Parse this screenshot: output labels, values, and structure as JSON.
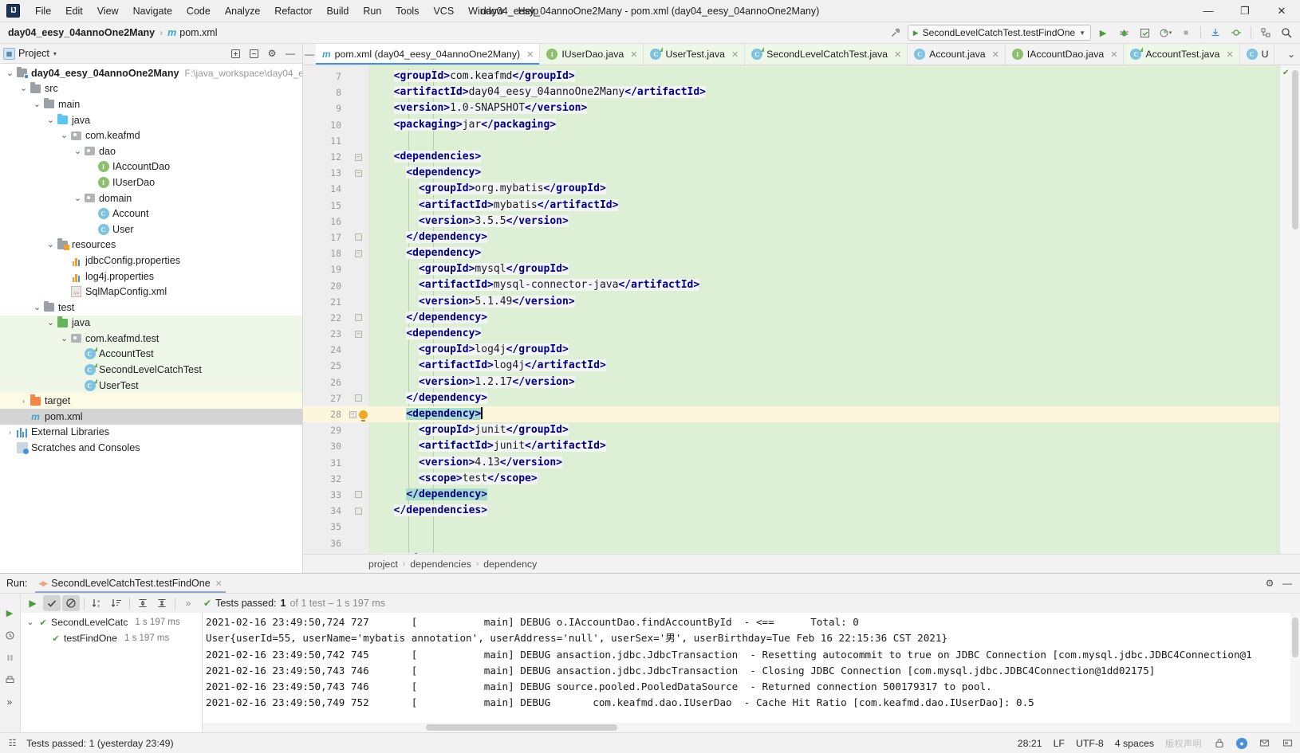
{
  "titlebar": {
    "logo": "IJ",
    "menus": [
      "File",
      "Edit",
      "View",
      "Navigate",
      "Code",
      "Analyze",
      "Refactor",
      "Build",
      "Run",
      "Tools",
      "VCS",
      "Window",
      "Help"
    ],
    "window_title": "day04_eesy_04annoOne2Many - pom.xml (day04_eesy_04annoOne2Many)",
    "minimize": "—",
    "maximize": "❐",
    "close": "✕"
  },
  "navbar": {
    "project": "day04_eesy_04annoOne2Many",
    "separator": "›",
    "file_icon": "m",
    "file": "pom.xml",
    "build_icon": "build-hammer-icon",
    "run_config": "SecondLevelCatchTest.testFindOne",
    "run_button": "▶",
    "debug_button": "🐞",
    "coverage_button": "▣",
    "profile_button": "◔",
    "stop_button": "■",
    "layout_button": "☷",
    "search_everywhere": "🔍",
    "settings_button": "⚙"
  },
  "project_panel": {
    "title": "Project",
    "chevron": "▾",
    "collapse_all": "–",
    "expand_all": "≡",
    "settings": "⚙",
    "hide": "—",
    "tree": [
      {
        "depth": 0,
        "label": "day04_eesy_04annoOne2Many",
        "sub": "F:\\java_workspace\\day04_ee",
        "icon": "module-folder",
        "arrow": "⌄",
        "bold": true,
        "state": "none"
      },
      {
        "depth": 1,
        "label": "src",
        "sub": "",
        "icon": "folder-gray",
        "arrow": "⌄",
        "bold": false,
        "state": "none"
      },
      {
        "depth": 2,
        "label": "main",
        "sub": "",
        "icon": "folder-gray",
        "arrow": "⌄",
        "bold": false,
        "state": "none"
      },
      {
        "depth": 3,
        "label": "java",
        "sub": "",
        "icon": "folder-blue",
        "arrow": "⌄",
        "bold": false,
        "state": "none"
      },
      {
        "depth": 4,
        "label": "com.keafmd",
        "sub": "",
        "icon": "package",
        "arrow": "⌄",
        "bold": false,
        "state": "none"
      },
      {
        "depth": 5,
        "label": "dao",
        "sub": "",
        "icon": "package",
        "arrow": "⌄",
        "bold": false,
        "state": "none"
      },
      {
        "depth": 6,
        "label": "IAccountDao",
        "sub": "",
        "icon": "interface",
        "arrow": "",
        "bold": false,
        "state": "none"
      },
      {
        "depth": 6,
        "label": "IUserDao",
        "sub": "",
        "icon": "interface",
        "arrow": "",
        "bold": false,
        "state": "none"
      },
      {
        "depth": 5,
        "label": "domain",
        "sub": "",
        "icon": "package",
        "arrow": "⌄",
        "bold": false,
        "state": "none"
      },
      {
        "depth": 6,
        "label": "Account",
        "sub": "",
        "icon": "class",
        "arrow": "",
        "bold": false,
        "state": "none"
      },
      {
        "depth": 6,
        "label": "User",
        "sub": "",
        "icon": "class",
        "arrow": "",
        "bold": false,
        "state": "none"
      },
      {
        "depth": 3,
        "label": "resources",
        "sub": "",
        "icon": "folder-resources",
        "arrow": "⌄",
        "bold": false,
        "state": "none"
      },
      {
        "depth": 4,
        "label": "jdbcConfig.properties",
        "sub": "",
        "icon": "properties",
        "arrow": "",
        "bold": false,
        "state": "none"
      },
      {
        "depth": 4,
        "label": "log4j.properties",
        "sub": "",
        "icon": "properties",
        "arrow": "",
        "bold": false,
        "state": "none"
      },
      {
        "depth": 4,
        "label": "SqlMapConfig.xml",
        "sub": "",
        "icon": "xml",
        "arrow": "",
        "bold": false,
        "state": "none"
      },
      {
        "depth": 2,
        "label": "test",
        "sub": "",
        "icon": "folder-gray",
        "arrow": "⌄",
        "bold": false,
        "state": "none"
      },
      {
        "depth": 3,
        "label": "java",
        "sub": "",
        "icon": "folder-green",
        "arrow": "⌄",
        "bold": false,
        "state": "green"
      },
      {
        "depth": 4,
        "label": "com.keafmd.test",
        "sub": "",
        "icon": "package",
        "arrow": "⌄",
        "bold": false,
        "state": "green"
      },
      {
        "depth": 5,
        "label": "AccountTest",
        "sub": "",
        "icon": "testclass",
        "arrow": "",
        "bold": false,
        "state": "green"
      },
      {
        "depth": 5,
        "label": "SecondLevelCatchTest",
        "sub": "",
        "icon": "testclass",
        "arrow": "",
        "bold": false,
        "state": "green"
      },
      {
        "depth": 5,
        "label": "UserTest",
        "sub": "",
        "icon": "testclass",
        "arrow": "",
        "bold": false,
        "state": "green"
      },
      {
        "depth": 1,
        "label": "target",
        "sub": "",
        "icon": "folder-orange",
        "arrow": "›",
        "bold": false,
        "state": "yellow"
      },
      {
        "depth": 1,
        "label": "pom.xml",
        "sub": "",
        "icon": "maven",
        "arrow": "",
        "bold": false,
        "state": "selected"
      },
      {
        "depth": 0,
        "label": "External Libraries",
        "sub": "",
        "icon": "libraries",
        "arrow": "›",
        "bold": false,
        "state": "none"
      },
      {
        "depth": 0,
        "label": "Scratches and Consoles",
        "sub": "",
        "icon": "scratches",
        "arrow": "",
        "bold": false,
        "state": "none"
      }
    ]
  },
  "editor": {
    "collapse_icon": "—",
    "tabs": [
      {
        "label": "pom.xml (day04_eesy_04annoOne2Many)",
        "icon": "maven",
        "active": true,
        "test": false,
        "close": "✕"
      },
      {
        "label": "IUserDao.java",
        "icon": "interface",
        "active": false,
        "test": true,
        "close": "✕"
      },
      {
        "label": "UserTest.java",
        "icon": "testclass",
        "active": false,
        "test": true,
        "close": "✕"
      },
      {
        "label": "SecondLevelCatchTest.java",
        "icon": "testclass",
        "active": false,
        "test": true,
        "close": "✕"
      },
      {
        "label": "Account.java",
        "icon": "class",
        "active": false,
        "test": false,
        "close": "✕"
      },
      {
        "label": "IAccountDao.java",
        "icon": "interface",
        "active": false,
        "test": false,
        "close": "✕"
      },
      {
        "label": "AccountTest.java",
        "icon": "testclass",
        "active": false,
        "test": true,
        "close": "✕"
      },
      {
        "label": "U",
        "icon": "class",
        "active": false,
        "test": false,
        "close": ""
      }
    ],
    "tab_overflow": "⌄",
    "first_line": 7,
    "caret_line": 28,
    "inspection_ok": "✔",
    "lines": [
      {
        "n": 7,
        "indent": 2,
        "fold": "",
        "bulb": false,
        "html": "<span class='tg'>&lt;groupId&gt;</span><span class='tv'>com.keafmd</span><span class='tg'>&lt;/groupId&gt;</span>"
      },
      {
        "n": 8,
        "indent": 2,
        "fold": "",
        "bulb": false,
        "html": "<span class='tg'>&lt;artifactId&gt;</span><span class='tv'>day04_eesy_04annoOne2Many</span><span class='tg'>&lt;/artifactId&gt;</span>"
      },
      {
        "n": 9,
        "indent": 2,
        "fold": "",
        "bulb": false,
        "html": "<span class='tg'>&lt;version&gt;</span><span class='tv'>1.0-SNAPSHOT</span><span class='tg'>&lt;/version&gt;</span>"
      },
      {
        "n": 10,
        "indent": 2,
        "fold": "",
        "bulb": false,
        "html": "<span class='tg'>&lt;packaging&gt;</span><span class='tv'>jar</span><span class='tg'>&lt;/packaging&gt;</span>"
      },
      {
        "n": 11,
        "indent": 0,
        "fold": "",
        "bulb": false,
        "html": ""
      },
      {
        "n": 12,
        "indent": 2,
        "fold": "-",
        "bulb": false,
        "html": "<span class='tg'>&lt;dependencies&gt;</span>"
      },
      {
        "n": 13,
        "indent": 4,
        "fold": "-",
        "bulb": false,
        "html": "<span class='tg'>&lt;dependency&gt;</span>"
      },
      {
        "n": 14,
        "indent": 6,
        "fold": "",
        "bulb": false,
        "html": "<span class='tg'>&lt;groupId&gt;</span><span class='tv'>org.mybatis</span><span class='tg'>&lt;/groupId&gt;</span>"
      },
      {
        "n": 15,
        "indent": 6,
        "fold": "",
        "bulb": false,
        "html": "<span class='tg'>&lt;artifactId&gt;</span><span class='tv'>mybatis</span><span class='tg'>&lt;/artifactId&gt;</span>"
      },
      {
        "n": 16,
        "indent": 6,
        "fold": "",
        "bulb": false,
        "html": "<span class='tg'>&lt;version&gt;</span><span class='tv'>3.5.5</span><span class='tg'>&lt;/version&gt;</span>"
      },
      {
        "n": 17,
        "indent": 4,
        "fold": "+",
        "bulb": false,
        "html": "<span class='tg'>&lt;/dependency&gt;</span>"
      },
      {
        "n": 18,
        "indent": 4,
        "fold": "-",
        "bulb": false,
        "html": "<span class='tg'>&lt;dependency&gt;</span>"
      },
      {
        "n": 19,
        "indent": 6,
        "fold": "",
        "bulb": false,
        "html": "<span class='tg'>&lt;groupId&gt;</span><span class='tv'>mysql</span><span class='tg'>&lt;/groupId&gt;</span>"
      },
      {
        "n": 20,
        "indent": 6,
        "fold": "",
        "bulb": false,
        "html": "<span class='tg'>&lt;artifactId&gt;</span><span class='tv'>mysql-connector-java</span><span class='tg'>&lt;/artifactId&gt;</span>"
      },
      {
        "n": 21,
        "indent": 6,
        "fold": "",
        "bulb": false,
        "html": "<span class='tg'>&lt;version&gt;</span><span class='tv'>5.1.49</span><span class='tg'>&lt;/version&gt;</span>"
      },
      {
        "n": 22,
        "indent": 4,
        "fold": "+",
        "bulb": false,
        "html": "<span class='tg'>&lt;/dependency&gt;</span>"
      },
      {
        "n": 23,
        "indent": 4,
        "fold": "-",
        "bulb": false,
        "html": "<span class='tg'>&lt;dependency&gt;</span>"
      },
      {
        "n": 24,
        "indent": 6,
        "fold": "",
        "bulb": false,
        "html": "<span class='tg'>&lt;groupId&gt;</span><span class='tv'>log4j</span><span class='tg'>&lt;/groupId&gt;</span>"
      },
      {
        "n": 25,
        "indent": 6,
        "fold": "",
        "bulb": false,
        "html": "<span class='tg'>&lt;artifactId&gt;</span><span class='tv'>log4j</span><span class='tg'>&lt;/artifactId&gt;</span>"
      },
      {
        "n": 26,
        "indent": 6,
        "fold": "",
        "bulb": false,
        "html": "<span class='tg'>&lt;version&gt;</span><span class='tv'>1.2.17</span><span class='tg'>&lt;/version&gt;</span>"
      },
      {
        "n": 27,
        "indent": 4,
        "fold": "+",
        "bulb": false,
        "html": "<span class='tg'>&lt;/dependency&gt;</span>"
      },
      {
        "n": 28,
        "indent": 4,
        "fold": "-",
        "bulb": true,
        "cur": true,
        "html": "<span class='tg match'>&lt;dependency&gt;</span><span class='caret'></span>"
      },
      {
        "n": 29,
        "indent": 6,
        "fold": "",
        "bulb": false,
        "html": "<span class='tg'>&lt;groupId&gt;</span><span class='tv'>junit</span><span class='tg'>&lt;/groupId&gt;</span>"
      },
      {
        "n": 30,
        "indent": 6,
        "fold": "",
        "bulb": false,
        "html": "<span class='tg'>&lt;artifactId&gt;</span><span class='tv'>junit</span><span class='tg'>&lt;/artifactId&gt;</span>"
      },
      {
        "n": 31,
        "indent": 6,
        "fold": "",
        "bulb": false,
        "html": "<span class='tg'>&lt;version&gt;</span><span class='tv'>4.13</span><span class='tg'>&lt;/version&gt;</span>"
      },
      {
        "n": 32,
        "indent": 6,
        "fold": "",
        "bulb": false,
        "html": "<span class='tg'>&lt;scope&gt;</span><span class='tv'>test</span><span class='tg'>&lt;/scope&gt;</span>"
      },
      {
        "n": 33,
        "indent": 4,
        "fold": "+",
        "bulb": false,
        "html": "<span class='tg match'>&lt;/dependency&gt;</span>"
      },
      {
        "n": 34,
        "indent": 2,
        "fold": "+",
        "bulb": false,
        "html": "<span class='tg'>&lt;/dependencies&gt;</span>"
      },
      {
        "n": 35,
        "indent": 0,
        "fold": "",
        "bulb": false,
        "html": ""
      },
      {
        "n": 36,
        "indent": 0,
        "fold": "",
        "bulb": false,
        "html": ""
      },
      {
        "n": 37,
        "indent": 0,
        "fold": "+",
        "bulb": false,
        "html": "<span class='tg'>&lt;/project&gt;</span>"
      }
    ],
    "breadcrumb": [
      "project",
      "dependencies",
      "dependency"
    ],
    "breadcrumb_sep": "›"
  },
  "run_panel": {
    "label": "Run:",
    "tab_title": "SecondLevelCatchTest.testFindOne",
    "tab_close": "✕",
    "header_buttons": [
      "⚙",
      "—"
    ],
    "left_strip": [
      "▶",
      "↻",
      "❙❙",
      "■",
      "Ὕ1"
    ],
    "toolbar": {
      "rerun": "▶",
      "show_passed": "✔",
      "hide_ignored": "⊘",
      "sort_alpha": "↓",
      "sort_duration": "↓",
      "expand_all": "⤓",
      "collapse_all": "⤒",
      "more": "»"
    },
    "status": {
      "check": "✔",
      "label": "Tests passed:",
      "count": "1",
      "detail": "of 1 test – 1 s 197 ms"
    },
    "test_tree": [
      {
        "depth": 0,
        "arrow": "⌄",
        "check": "✔",
        "name": "SecondLevelCatc",
        "time": "1 s 197 ms"
      },
      {
        "depth": 1,
        "arrow": "",
        "check": "✔",
        "name": "testFindOne",
        "time": "1 s 197 ms"
      }
    ],
    "console_lines": [
      "2021-02-16 23:49:50,724 727       [           main] DEBUG o.IAccountDao.findAccountById  - <==      Total: 0",
      "User{userId=55, userName='mybatis annotation', userAddress='null', userSex='男', userBirthday=Tue Feb 16 22:15:36 CST 2021}",
      "2021-02-16 23:49:50,742 745       [           main] DEBUG ansaction.jdbc.JdbcTransaction  - Resetting autocommit to true on JDBC Connection [com.mysql.jdbc.JDBC4Connection@1",
      "2021-02-16 23:49:50,743 746       [           main] DEBUG ansaction.jdbc.JdbcTransaction  - Closing JDBC Connection [com.mysql.jdbc.JDBC4Connection@1dd02175]",
      "2021-02-16 23:49:50,743 746       [           main] DEBUG source.pooled.PooledDataSource  - Returned connection 500179317 to pool.",
      "2021-02-16 23:49:50,749 752       [           main] DEBUG       com.keafmd.dao.IUserDao  - Cache Hit Ratio [com.keafmd.dao.IUserDao]: 0.5"
    ]
  },
  "statusbar": {
    "icon": "☷",
    "message": "Tests passed: 1 (yesterday 23:49)",
    "caret_pos": "28:21",
    "line_sep": "LF",
    "encoding": "UTF-8",
    "indent": "4 spaces",
    "watermark": "版权声明",
    "lock": "🔒",
    "git": "⎇",
    "notif": "✉",
    "mem": "▤"
  }
}
